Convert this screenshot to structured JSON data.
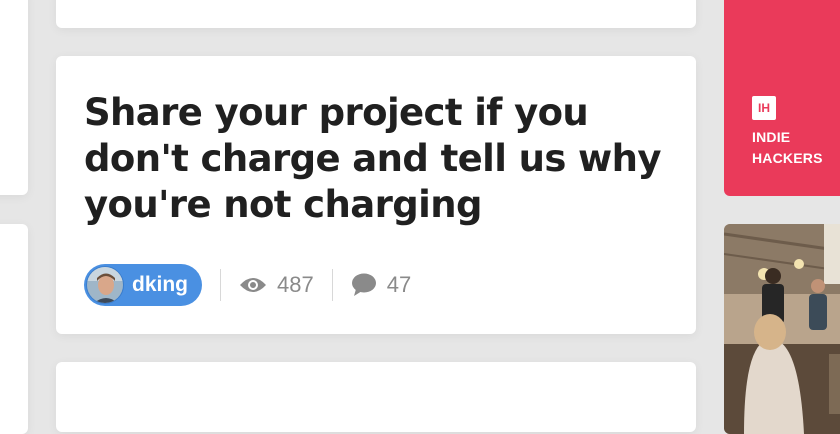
{
  "post": {
    "title": "Share your project if you don't charge and tell us why you're not charging",
    "author": "dking",
    "views": "487",
    "comments": "47"
  },
  "brand": {
    "logo_text": "IH",
    "line1": "INDIE",
    "line2": "HACKERS",
    "color": "#ea3a5a"
  },
  "icons": [
    "eye-icon",
    "comment-icon"
  ],
  "colors": {
    "user_pill": "#4a90e2",
    "meta_text": "#8a8a8a",
    "title": "#202020"
  }
}
